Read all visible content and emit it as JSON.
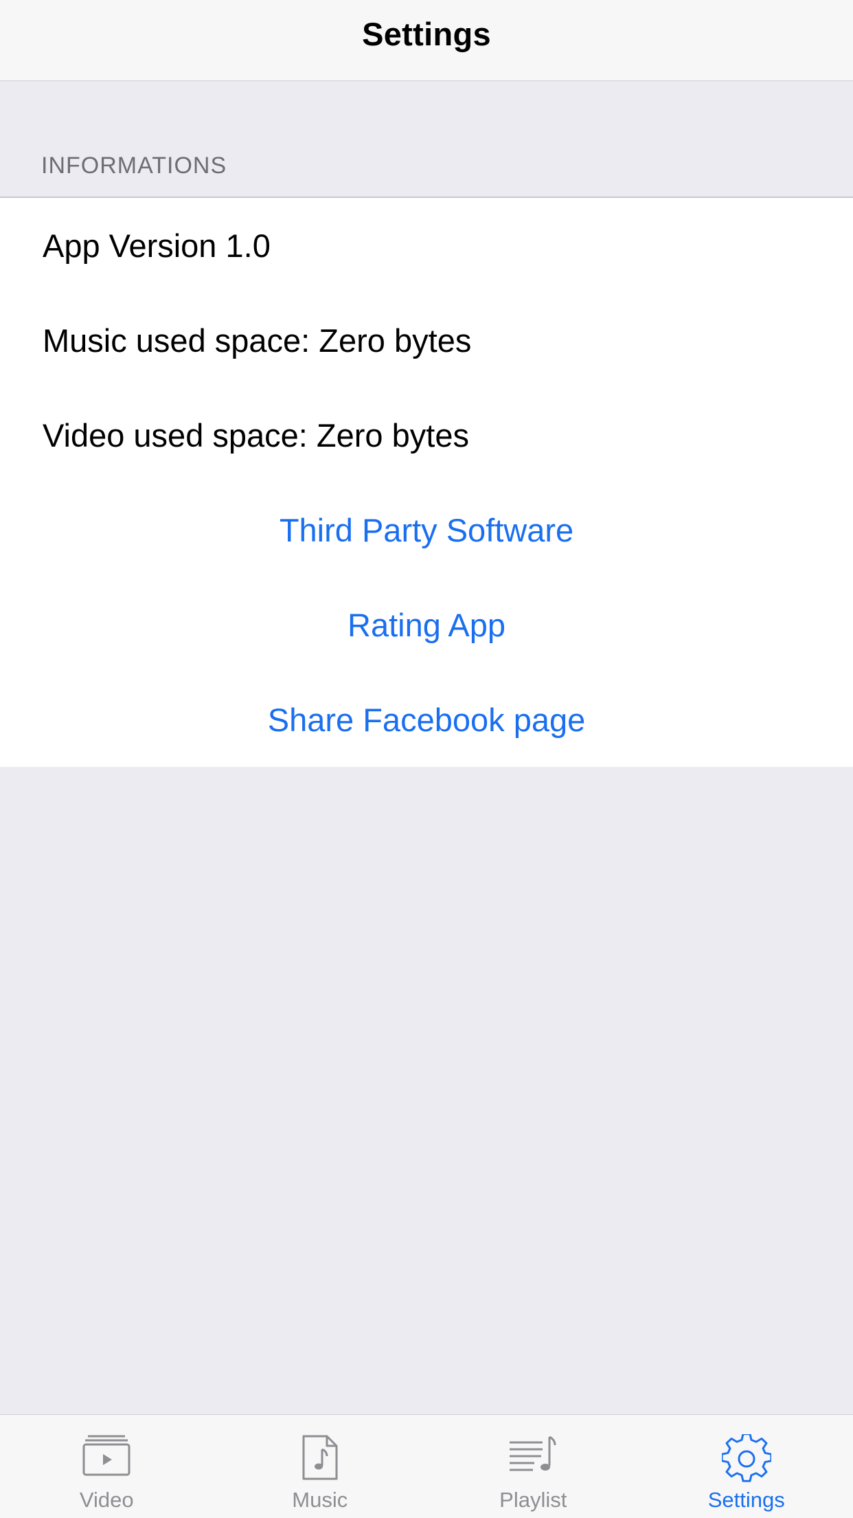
{
  "header": {
    "title": "Settings"
  },
  "section": {
    "title": "INFORMATIONS",
    "info_rows": [
      "App Version 1.0",
      "Music used space: Zero bytes",
      "Video used space: Zero bytes"
    ],
    "link_rows": [
      "Third Party Software",
      "Rating App",
      "Share Facebook page"
    ]
  },
  "tabbar": {
    "tabs": [
      {
        "label": "Video",
        "icon": "video-icon",
        "active": false
      },
      {
        "label": "Music",
        "icon": "music-note-icon",
        "active": false
      },
      {
        "label": "Playlist",
        "icon": "playlist-icon",
        "active": false
      },
      {
        "label": "Settings",
        "icon": "gear-icon",
        "active": true
      }
    ]
  },
  "colors": {
    "accent": "#1a6ff0",
    "inactive": "#8e8e93",
    "background": "#ebebf1"
  }
}
